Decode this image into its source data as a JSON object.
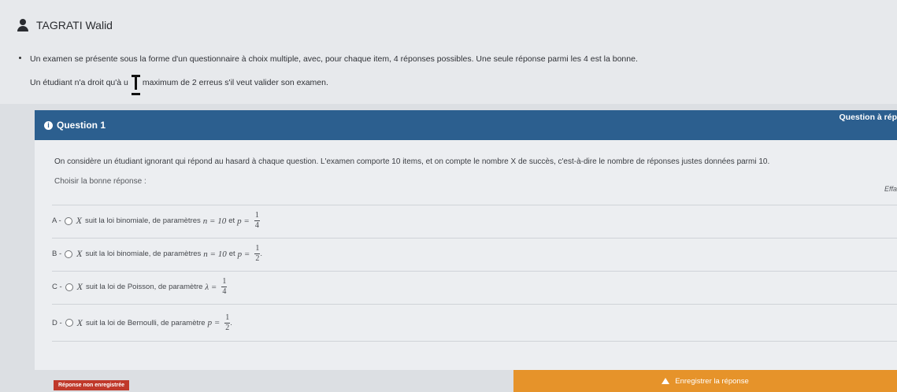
{
  "user": {
    "name": "TAGRATI Walid"
  },
  "intro": {
    "line1": "Un examen se présente sous la forme d'un questionnaire à choix multiple, avec, pour chaque item, 4 réponses possibles. Une seule réponse parmi les 4 est la bonne.",
    "line2_start": "Un étudiant n'a droit qu'à u",
    "line2_end": "maximum de 2 erreus s'il veut valider son examen."
  },
  "question": {
    "title": "Question 1",
    "right_label": "Question à rép",
    "statement": "On considère un étudiant ignorant qui répond au hasard à chaque question. L'examen comporte 10 items, et on compte le nombre X de succès, c'est-à-dire le nombre de réponses justes données parmi 10.",
    "choose_label": "Choisir la bonne réponse :",
    "side_label": "Effa"
  },
  "options": [
    {
      "letter": "A -",
      "var": "X",
      "text": "suit la loi binomiale, de paramètres",
      "eq1": "n = 10",
      "mid": "et",
      "eq2": "p =",
      "num": "1",
      "den": "4",
      "tail": ""
    },
    {
      "letter": "B -",
      "var": "X",
      "text": "suit la loi binomiale, de paramètres",
      "eq1": "n = 10",
      "mid": "et",
      "eq2": "p =",
      "num": "1",
      "den": "2",
      "tail": "."
    },
    {
      "letter": "C -",
      "var": "X",
      "text": "suit la loi de Poisson, de paramètre",
      "eq1": "λ =",
      "mid": "",
      "eq2": "",
      "num": "1",
      "den": "4",
      "tail": ""
    },
    {
      "letter": "D -",
      "var": "X",
      "text": "suit la loi de Bernoulli, de paramètre",
      "eq1": "p =",
      "mid": "",
      "eq2": "",
      "num": "1",
      "den": "2",
      "tail": "."
    }
  ],
  "footer": {
    "warning": "Réponse non enregistrée",
    "save_label": "Enregistrer la réponse"
  },
  "icons": {
    "user": "user-icon",
    "info": "info-icon",
    "save": "upload-icon"
  },
  "colors": {
    "header": "#2c5f8f",
    "save_button": "#e6932a",
    "warning": "#c0392b"
  }
}
